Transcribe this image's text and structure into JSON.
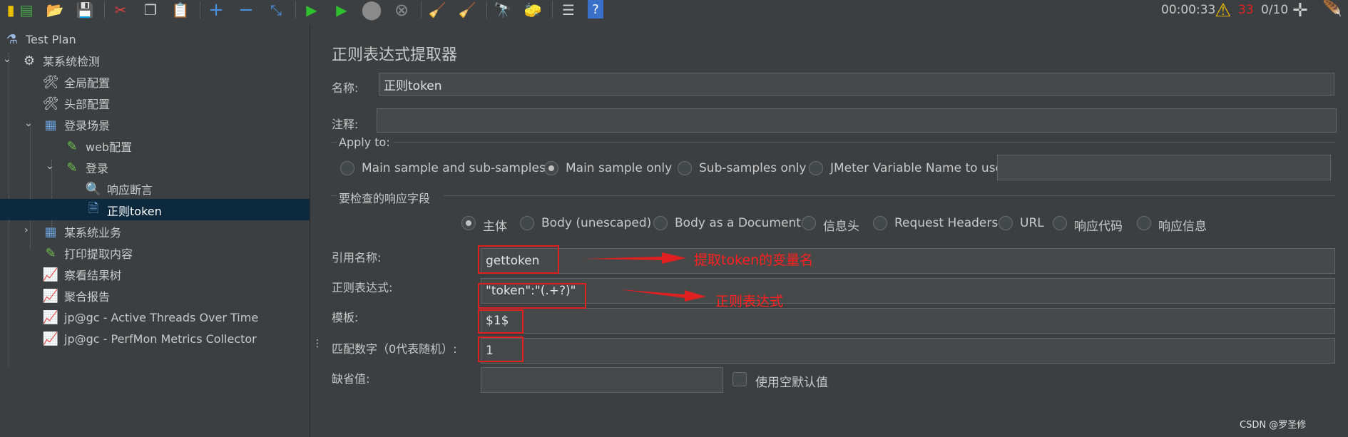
{
  "status": {
    "timer": "00:00:33",
    "warnings": "33",
    "threads": "0/10"
  },
  "tree": {
    "items": [
      {
        "label": "Test Plan"
      },
      {
        "label": "某系统检测"
      },
      {
        "label": "全局配置"
      },
      {
        "label": "头部配置"
      },
      {
        "label": "登录场景"
      },
      {
        "label": "web配置"
      },
      {
        "label": "登录"
      },
      {
        "label": "响应断言"
      },
      {
        "label": "正则token"
      },
      {
        "label": "某系统业务"
      },
      {
        "label": "打印提取内容"
      },
      {
        "label": "察看结果树"
      },
      {
        "label": "聚合报告"
      },
      {
        "label": "jp@gc - Active Threads Over Time"
      },
      {
        "label": "jp@gc - PerfMon Metrics Collector"
      }
    ]
  },
  "panel": {
    "title": "正则表达式提取器",
    "name_label": "名称:",
    "name_value": "正则token",
    "comment_label": "注释:",
    "comment_value": "",
    "apply_to": {
      "legend": "Apply to:",
      "options": [
        "Main sample and sub-samples",
        "Main sample only",
        "Sub-samples only",
        "JMeter Variable Name to use"
      ],
      "selected": "Main sample only",
      "var_value": ""
    },
    "field_check": {
      "legend": "要检查的响应字段",
      "options": [
        "主体",
        "Body (unescaped)",
        "Body as a Document",
        "信息头",
        "Request Headers",
        "URL",
        "响应代码",
        "响应信息"
      ],
      "selected": "主体"
    },
    "ref_name_label": "引用名称:",
    "ref_name_value": "gettoken",
    "regex_label": "正则表达式:",
    "regex_value": "\"token\":\"(.+?)\"",
    "template_label": "模板:",
    "template_value": "$1$",
    "match_no_label": "匹配数字（0代表随机）:",
    "match_no_value": "1",
    "default_label": "缺省值:",
    "default_value": "",
    "use_empty_label": "使用空默认值"
  },
  "annotations": {
    "ref_note": "提取token的变量名",
    "regex_note": "正则表达式"
  },
  "watermark": "CSDN @罗圣修",
  "colors": {
    "accent_red": "#e02020",
    "selection": "#0d293e",
    "background": "#3c3f41"
  }
}
